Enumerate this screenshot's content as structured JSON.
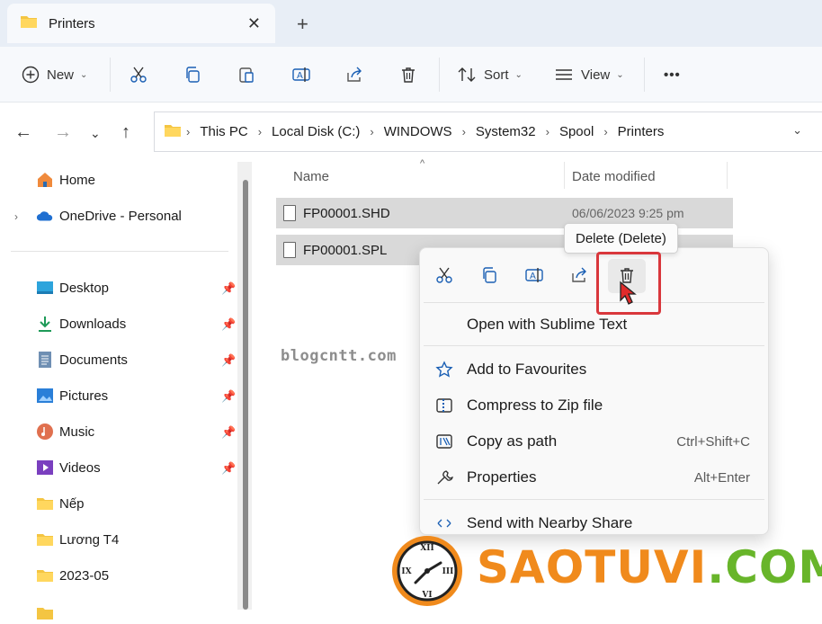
{
  "tab": {
    "title": "Printers",
    "close": "✕",
    "new": "+"
  },
  "toolbar": {
    "new_label": "New",
    "sort_label": "Sort",
    "view_label": "View",
    "more": "•••"
  },
  "address": {
    "crumbs": [
      "This PC",
      "Local Disk (C:)",
      "WINDOWS",
      "System32",
      "Spool",
      "Printers"
    ]
  },
  "sidebar": {
    "items": [
      {
        "label": "Home",
        "icon": "home-icon"
      },
      {
        "label": "OneDrive - Personal",
        "icon": "cloud-icon"
      },
      {
        "label": "Desktop",
        "icon": "desktop-icon",
        "pinned": true
      },
      {
        "label": "Downloads",
        "icon": "download-icon",
        "pinned": true
      },
      {
        "label": "Documents",
        "icon": "document-icon",
        "pinned": true
      },
      {
        "label": "Pictures",
        "icon": "pictures-icon",
        "pinned": true
      },
      {
        "label": "Music",
        "icon": "music-icon",
        "pinned": true
      },
      {
        "label": "Videos",
        "icon": "videos-icon",
        "pinned": true
      },
      {
        "label": "Nếp",
        "icon": "folder-icon"
      },
      {
        "label": "Lương T4",
        "icon": "folder-icon"
      },
      {
        "label": "2023-05",
        "icon": "folder-icon"
      }
    ]
  },
  "files": {
    "columns": {
      "name": "Name",
      "date": "Date modified"
    },
    "rows": [
      {
        "name": "FP00001.SHD",
        "date": "06/06/2023 9:25 pm"
      },
      {
        "name": "FP00001.SPL",
        "date": ""
      }
    ]
  },
  "watermark": "blogcntt.com",
  "tooltip": "Delete (Delete)",
  "context_menu": {
    "items": [
      {
        "label": "Open with Sublime Text",
        "shortcut": ""
      },
      {
        "label": "Add to Favourites",
        "shortcut": ""
      },
      {
        "label": "Compress to Zip file",
        "shortcut": ""
      },
      {
        "label": "Copy as path",
        "shortcut": "Ctrl+Shift+C"
      },
      {
        "label": "Properties",
        "shortcut": "Alt+Enter"
      },
      {
        "label": "Send with Nearby Share",
        "shortcut": ""
      }
    ]
  },
  "logo": {
    "part1": "SAOTUVI",
    "part2": ".COM"
  },
  "colors": {
    "accent": "#0067c0",
    "highlight": "#d9373c",
    "logo_orange": "#f08a1c",
    "logo_green": "#68b52a"
  }
}
